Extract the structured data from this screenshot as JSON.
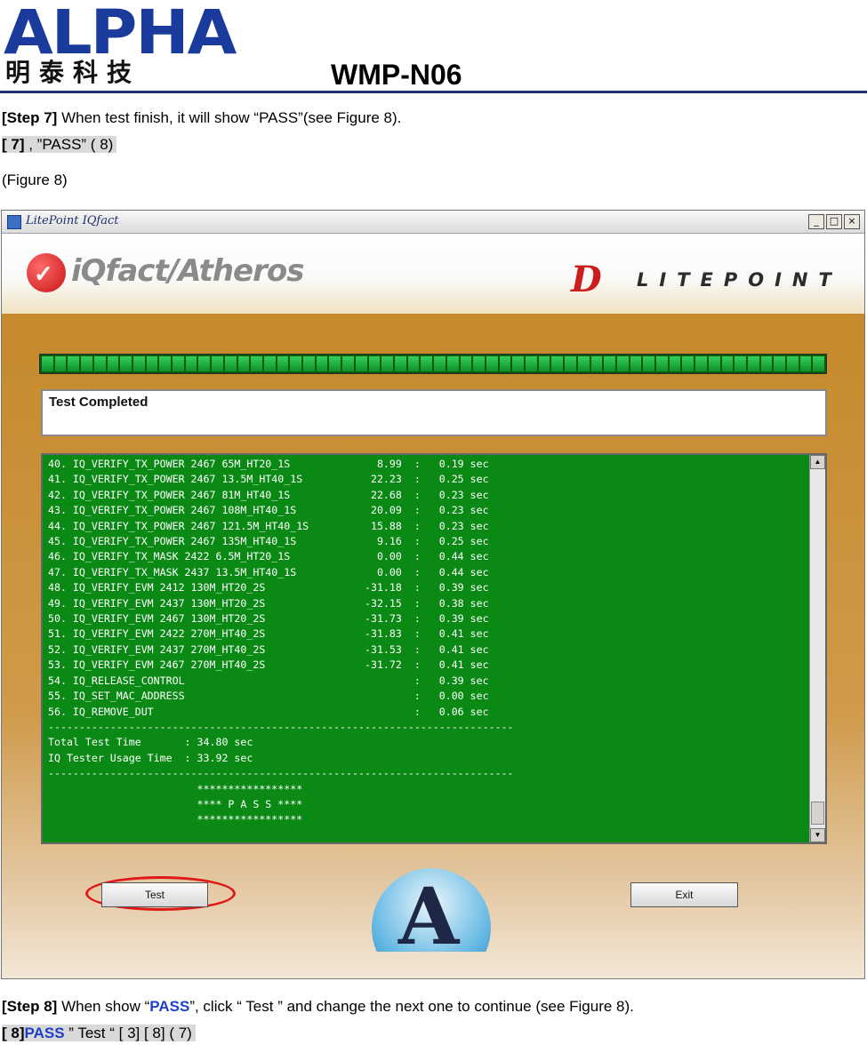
{
  "doc": {
    "logo_latin": "ALPHA",
    "logo_cjk": "明泰科技",
    "model": "WMP-N06",
    "step7_label": "[Step 7]",
    "step7_text": " When test finish, it will show “PASS”(see Figure 8).",
    "step7_cn_label": "[ 7]",
    "step7_cn_text": " ,  ”PASS” ( 8)",
    "figure_caption": "(Figure 8)",
    "step8_label": "[Step 8]",
    "step8_pre": " When show “",
    "step8_pass": "PASS",
    "step8_post": "”, click “ Test ” and change the next one to continue (see Figure 8).",
    "step8_cn_label": "[ 8]",
    "step8_cn_pass": "PASS",
    "step8_cn_text": " ” Test “ [ 3] [ 8] ( 7)"
  },
  "app": {
    "window_title": "LitePoint IQfact",
    "minimize_glyph": "_",
    "maximize_glyph": "□",
    "close_glyph": "×",
    "product_name": "iQfact/Atheros",
    "vendor_mark": "D",
    "vendor_name": "LITEPOINT",
    "progress_percent": 100,
    "status_text": "Test Completed",
    "log_lines": [
      "40. IQ_VERIFY_TX_POWER 2467 65M_HT20_1S              8.99  :   0.19 sec",
      "41. IQ_VERIFY_TX_POWER 2467 13.5M_HT40_1S           22.23  :   0.25 sec",
      "42. IQ_VERIFY_TX_POWER 2467 81M_HT40_1S             22.68  :   0.23 sec",
      "43. IQ_VERIFY_TX_POWER 2467 108M_HT40_1S            20.09  :   0.23 sec",
      "44. IQ_VERIFY_TX_POWER 2467 121.5M_HT40_1S          15.88  :   0.23 sec",
      "45. IQ_VERIFY_TX_POWER 2467 135M_HT40_1S             9.16  :   0.25 sec",
      "46. IQ_VERIFY_TX_MASK 2422 6.5M_HT20_1S              0.00  :   0.44 sec",
      "47. IQ_VERIFY_TX_MASK 2437 13.5M_HT40_1S             0.00  :   0.44 sec",
      "48. IQ_VERIFY_EVM 2412 130M_HT20_2S                -31.18  :   0.39 sec",
      "49. IQ_VERIFY_EVM 2437 130M_HT20_2S                -32.15  :   0.38 sec",
      "50. IQ_VERIFY_EVM 2467 130M_HT20_2S                -31.73  :   0.39 sec",
      "51. IQ_VERIFY_EVM 2422 270M_HT40_2S                -31.83  :   0.41 sec",
      "52. IQ_VERIFY_EVM 2437 270M_HT40_2S                -31.53  :   0.41 sec",
      "53. IQ_VERIFY_EVM 2467 270M_HT40_2S                -31.72  :   0.41 sec",
      "54. IQ_RELEASE_CONTROL                                     :   0.39 sec",
      "55. IQ_SET_MAC_ADDRESS                                     :   0.00 sec",
      "56. IQ_REMOVE_DUT                                          :   0.06 sec",
      "---------------------------------------------------------------------------",
      "Total Test Time       : 34.80 sec",
      "IQ Tester Usage Time  : 33.92 sec",
      "---------------------------------------------------------------------------",
      "                        *****************",
      "                        **** P A S S ****",
      "                        *****************"
    ],
    "scroll_up_glyph": "▲",
    "scroll_down_glyph": "▼",
    "test_button": "Test",
    "exit_button": "Exit",
    "emblem_letter": "A"
  },
  "colors": {
    "brand_blue": "#1a3a9c",
    "log_green": "#0a8a14",
    "highlight_red": "#e01818",
    "pass_blue": "#1d40c8"
  }
}
